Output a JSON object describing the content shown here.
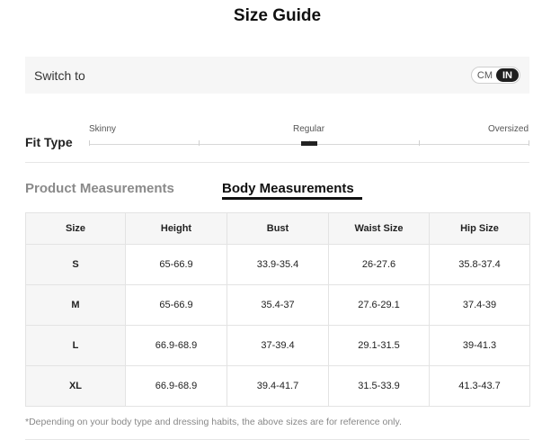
{
  "title": "Size Guide",
  "switch": {
    "label": "Switch to",
    "units": [
      "CM",
      "IN"
    ],
    "selected": "IN"
  },
  "fit": {
    "label": "Fit Type",
    "options": [
      "Skinny",
      "Regular",
      "Oversized"
    ],
    "selected": "Regular"
  },
  "tabs": {
    "product": "Product Measurements",
    "body": "Body Measurements",
    "active": "Body Measurements"
  },
  "table": {
    "headers": [
      "Size",
      "Height",
      "Bust",
      "Waist Size",
      "Hip Size"
    ],
    "rows": [
      [
        "S",
        "65-66.9",
        "33.9-35.4",
        "26-27.6",
        "35.8-37.4"
      ],
      [
        "M",
        "65-66.9",
        "35.4-37",
        "27.6-29.1",
        "37.4-39"
      ],
      [
        "L",
        "66.9-68.9",
        "37-39.4",
        "29.1-31.5",
        "39-41.3"
      ],
      [
        "XL",
        "66.9-68.9",
        "39.4-41.7",
        "31.5-33.9",
        "41.3-43.7"
      ]
    ]
  },
  "note": "*Depending on your body type and dressing habits, the above sizes are for reference only.",
  "colors": {
    "accent": "#1f1f1f",
    "panel_bg": "#f6f6f6",
    "muted_text": "#8a8a8a"
  }
}
